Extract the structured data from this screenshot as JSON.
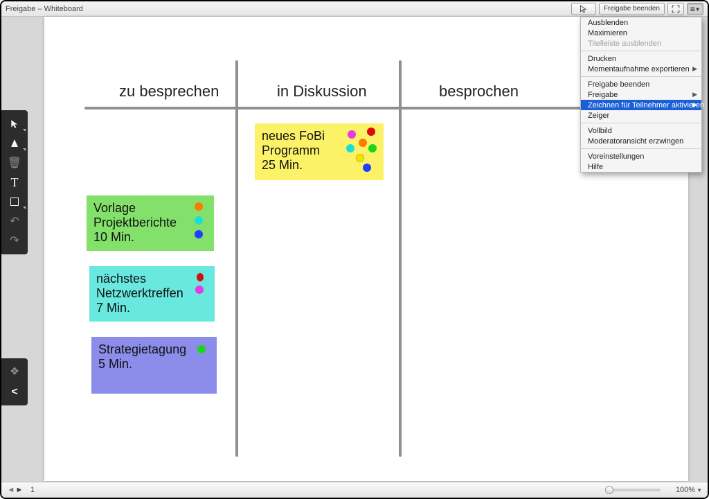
{
  "titlebar": {
    "title": "Freigabe – Whiteboard",
    "end_share_label": "Freigabe beenden"
  },
  "menu": {
    "items": [
      {
        "label": "Ausblenden",
        "disabled": false,
        "submenu": false
      },
      {
        "label": "Maximieren",
        "disabled": false,
        "submenu": false
      },
      {
        "label": "Titelleiste ausblenden",
        "disabled": true,
        "submenu": false
      }
    ],
    "group2": [
      {
        "label": "Drucken",
        "disabled": false,
        "submenu": false
      },
      {
        "label": "Momentaufnahme exportieren",
        "disabled": false,
        "submenu": true
      }
    ],
    "group3": [
      {
        "label": "Freigabe beenden",
        "disabled": false,
        "submenu": false
      },
      {
        "label": "Freigabe",
        "disabled": false,
        "submenu": true
      },
      {
        "label": "Zeichnen für Teilnehmer aktivieren",
        "disabled": false,
        "submenu": true,
        "highlight": true
      },
      {
        "label": "Zeiger",
        "disabled": false,
        "submenu": false
      }
    ],
    "group4": [
      {
        "label": "Vollbild",
        "disabled": false,
        "submenu": false
      },
      {
        "label": "Moderatoransicht erzwingen",
        "disabled": false,
        "submenu": false
      }
    ],
    "group5": [
      {
        "label": "Voreinstellungen",
        "disabled": false,
        "submenu": false
      },
      {
        "label": "Hilfe",
        "disabled": false,
        "submenu": false
      }
    ]
  },
  "columns": {
    "todo": "zu besprechen",
    "progress": "in Diskussion",
    "done": "besprochen"
  },
  "cards": {
    "c1": {
      "line1": "Vorlage",
      "line2": "Projektberichte",
      "line3": "10 Min.",
      "color": "#83E06B"
    },
    "c2": {
      "line1": "nächstes",
      "line2": "Netzwerktreffen",
      "line3": "7 Min.",
      "color": "#68E8DF"
    },
    "c3": {
      "line1": "Strategietagung",
      "line2": "5 Min.",
      "line3": "",
      "color": "#8C8CEB"
    },
    "c4": {
      "line1": "neues FoBi",
      "line2": "Programm",
      "line3": "25 Min.",
      "color": "#FBF268"
    }
  },
  "footer": {
    "page": "1",
    "zoom": "100%"
  }
}
